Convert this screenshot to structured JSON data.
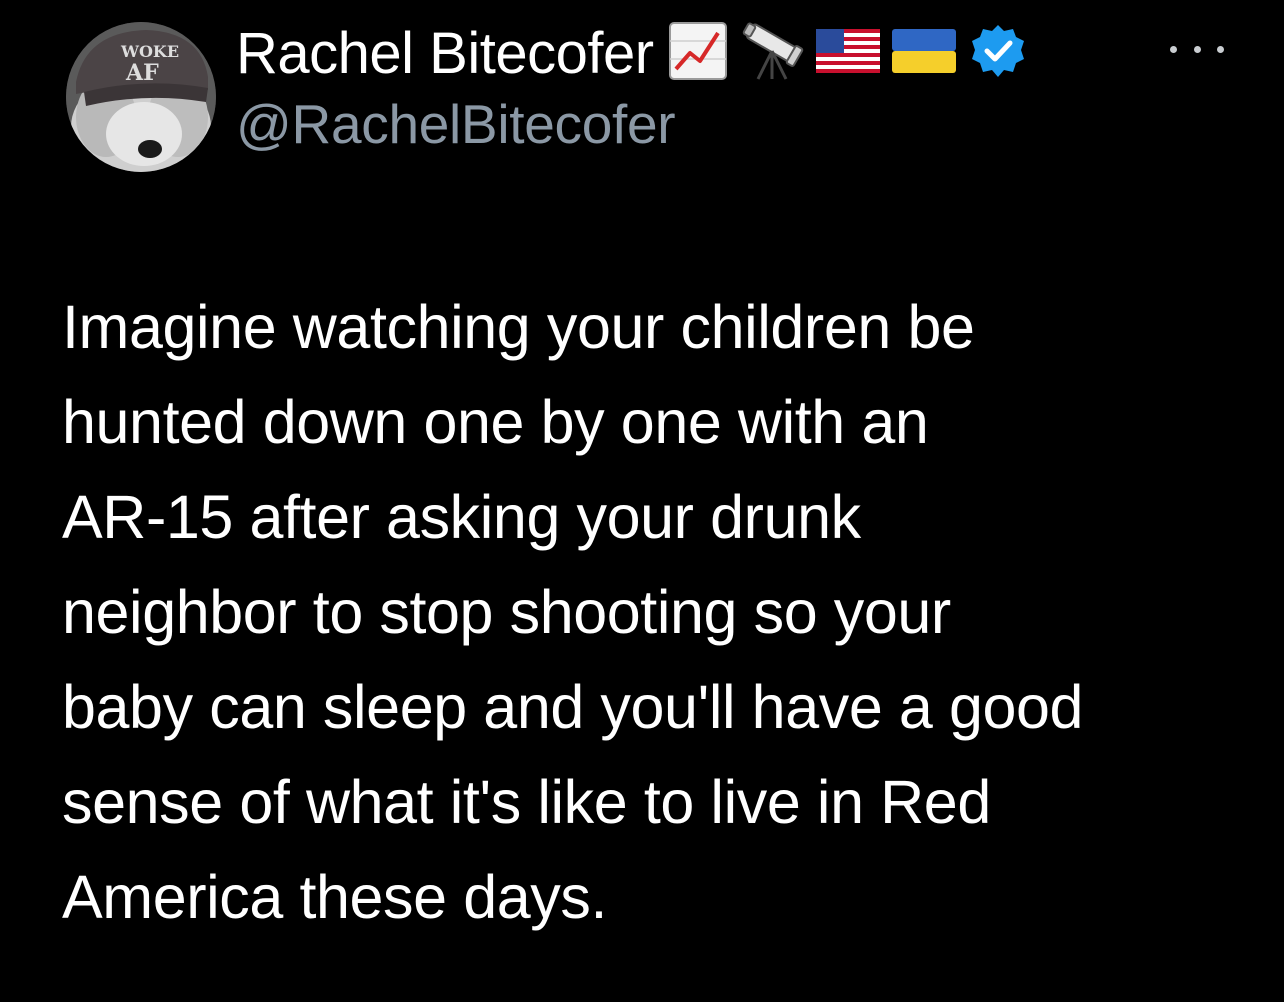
{
  "author": {
    "display_name": "Rachel Bitecofer",
    "handle": "@RachelBitecofer",
    "avatar_hat_text_top": "WOKE",
    "avatar_hat_text_bottom": "AF",
    "name_emojis": [
      "chart-increasing-icon",
      "telescope-icon",
      "us-flag-icon",
      "ukraine-flag-icon",
      "verified-badge-icon"
    ]
  },
  "tweet": {
    "text_lines": [
      "Imagine watching your children be",
      "hunted down one by one with an",
      "AR-15 after asking your drunk",
      "neighbor to stop shooting so your",
      "baby can sleep and you'll have a good",
      "sense of what it's like to live in Red",
      "America these days."
    ]
  },
  "colors": {
    "background": "#000000",
    "name": "#ffffff",
    "handle": "#8b98a5",
    "verified": "#1d9bf0"
  }
}
